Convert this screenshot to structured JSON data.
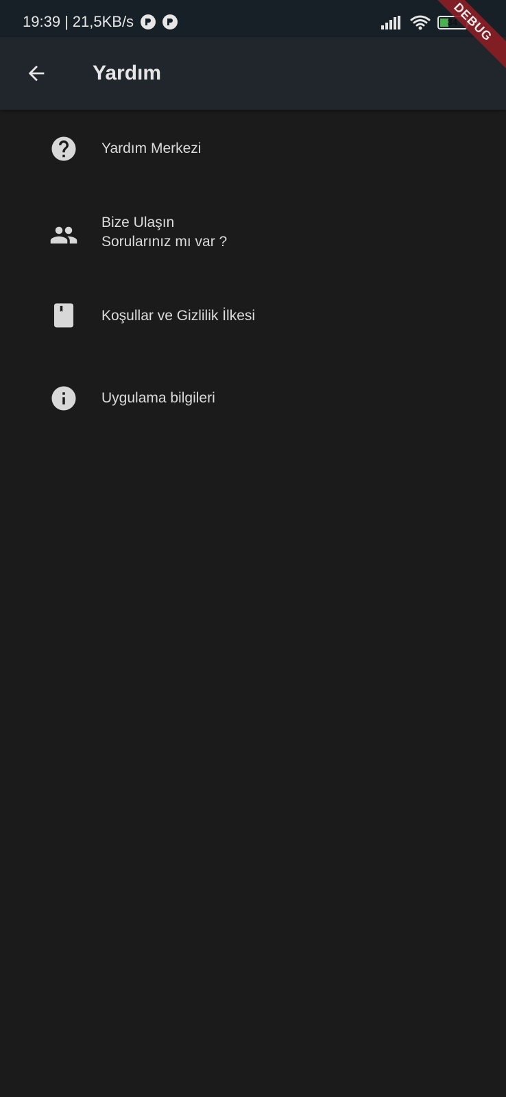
{
  "status_bar": {
    "time": "19:39",
    "separator": "|",
    "network_speed": "21,5KB/s",
    "battery_level": "34",
    "battery_fraction": 0.34,
    "icons": [
      "notification-icon",
      "notification-icon",
      "signal-icon",
      "wifi-icon",
      "battery-icon",
      "charging-icon"
    ]
  },
  "app_bar": {
    "title": "Yardım",
    "back_icon": "arrow-back-icon"
  },
  "menu": {
    "items": [
      {
        "label": "Yardım Merkezi",
        "icon": "help-circle-icon"
      },
      {
        "label": "Bize Ulaşın",
        "sublabel": "Sorularınız mı var ?",
        "icon": "people-icon"
      },
      {
        "label": "Koşullar ve Gizlilik İlkesi",
        "icon": "book-icon"
      },
      {
        "label": "Uygulama bilgileri",
        "icon": "info-icon"
      }
    ]
  },
  "debug_banner": "DEBUG",
  "colors": {
    "background": "#1b1b1b",
    "app_bar": "#20262c",
    "status_bar": "#172026",
    "text": "#e6e6e6",
    "icon": "#d8d8d8",
    "debug_banner": "#8b1e24",
    "battery_fill": "#4caf50"
  }
}
